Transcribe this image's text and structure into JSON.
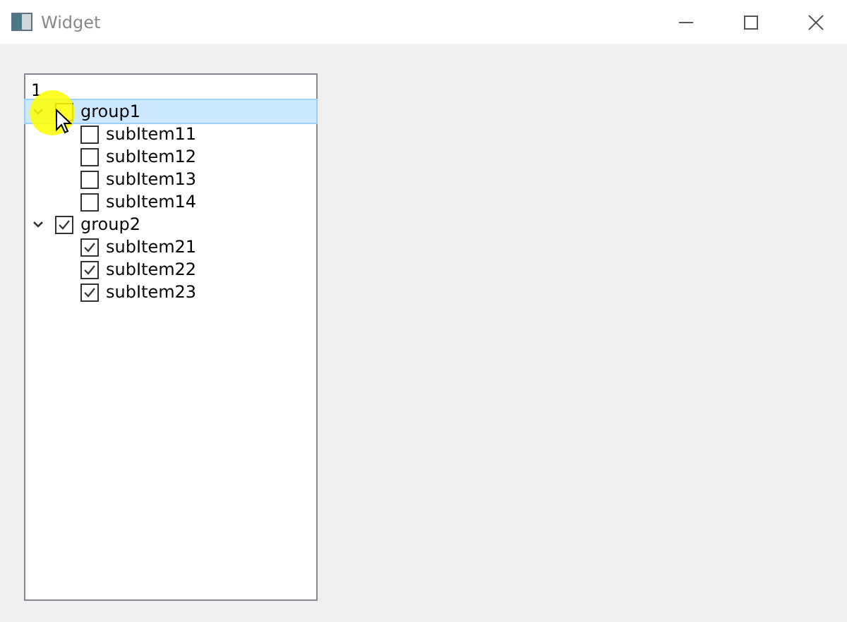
{
  "window": {
    "title": "Widget"
  },
  "tree": {
    "header": "1",
    "items": [
      {
        "label": "group1",
        "expanded": true,
        "checked": false,
        "selected": true,
        "children": [
          {
            "label": "subItem11",
            "checked": false,
            "selected": false
          },
          {
            "label": "subItem12",
            "checked": false,
            "selected": false
          },
          {
            "label": "subItem13",
            "checked": false,
            "selected": false
          },
          {
            "label": "subItem14",
            "checked": false,
            "selected": false
          }
        ]
      },
      {
        "label": "group2",
        "expanded": true,
        "checked": true,
        "selected": false,
        "children": [
          {
            "label": "subItem21",
            "checked": true,
            "selected": false
          },
          {
            "label": "subItem22",
            "checked": true,
            "selected": false
          },
          {
            "label": "subItem23",
            "checked": true,
            "selected": false
          }
        ]
      }
    ]
  }
}
